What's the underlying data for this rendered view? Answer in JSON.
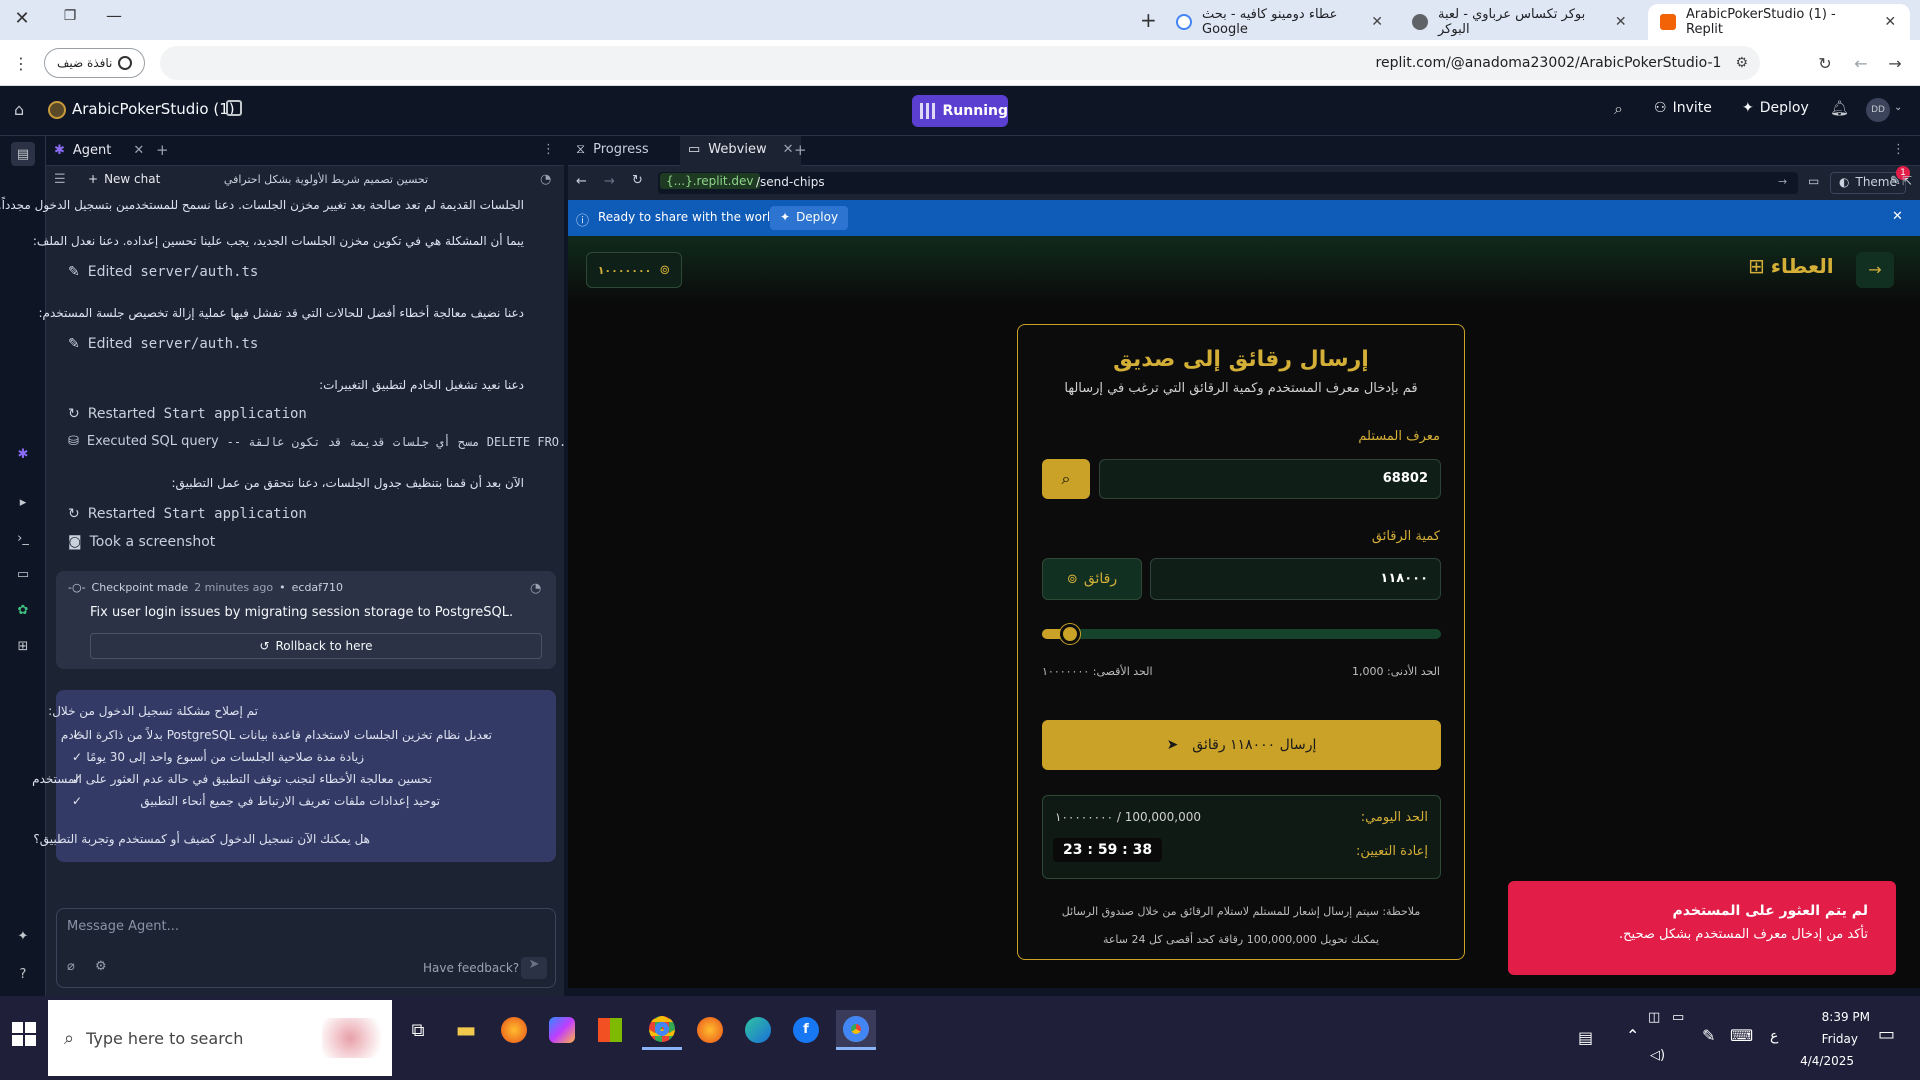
{
  "browser": {
    "tabs": [
      {
        "title": "ArabicPokerStudio (1) - Replit",
        "active": true
      },
      {
        "title": "بوكر تكساس عرباوي - لعبة البوكر",
        "active": false
      },
      {
        "title": "عطاء دومينو كافيه - بحث Google",
        "active": false
      }
    ],
    "url": "replit.com/@anadoma23002/ArabicPokerStudio-1",
    "guest_label": "نافذة ضيف"
  },
  "replit": {
    "project_name": "ArabicPokerStudio (1)",
    "run_status": "Running",
    "invite_label": "Invite",
    "deploy_label": "Deploy",
    "avatar_initials": "DD"
  },
  "agent": {
    "tab_label": "Agent",
    "new_chat_label": "New chat",
    "chat_title": "تحسين تصميم شريط الأولوية بشكل احترافي",
    "lines": [
      "الجلسات القديمة لم تعد صالحة بعد تغيير مخزن الجلسات. دعنا نسمح للمستخدمين بتسجيل الدخول مجدداً.",
      "يبما أن المشكلة هي في تكوين مخزن الجلسات الجديد، يجب علينا تحسين إعداده. دعنا نعدل الملف:",
      "دعنا نضيف معالجة أخطاء أفضل للحالات التي قد تفشل فيها عملية إزالة تخصيص جلسة المستخدم:",
      "دعنا نعيد تشغيل الخادم لتطبيق التغييرات:",
      "الآن بعد أن قمنا بتنظيف جدول الجلسات، دعنا نتحقق من عمل التطبيق:"
    ],
    "actions": [
      {
        "prefix": "Edited",
        "detail": "server/auth.ts"
      },
      {
        "prefix": "Edited",
        "detail": "server/auth.ts"
      },
      {
        "prefix": "Restarted",
        "detail": "Start application"
      },
      {
        "prefix": "Executed SQL query",
        "detail": "-- مسح أي جلسات قديمة قد تكون عالقة DELETE FRO..."
      },
      {
        "prefix": "Restarted",
        "detail": "Start application"
      },
      {
        "prefix": "Took a screenshot",
        "detail": ""
      }
    ],
    "checkpoint": {
      "label": "Checkpoint made",
      "time": "2 minutes ago",
      "commit": "ecdaf710",
      "message": "Fix user login issues by migrating session storage to PostgreSQL.",
      "rollback_label": "Rollback to here"
    },
    "summary": {
      "intro": "تم إصلاح مشكلة تسجيل الدخول من خلال:",
      "items": [
        "تعديل نظام تخزين الجلسات لاستخدام قاعدة بيانات PostgreSQL بدلاً من ذاكرة الخادم",
        "زيادة مدة صلاحية الجلسات من أسبوع واحد إلى 30 يومًا",
        "تحسين معالجة الأخطاء لتجنب توقف التطبيق في حالة عدم العثور على المستخدم",
        "توحيد إعدادات ملفات تعريف الارتباط في جميع أنحاء التطبيق"
      ],
      "question": "هل يمكنك الآن تسجيل الدخول كضيف أو كمستخدم وتجربة التطبيق؟"
    },
    "message_placeholder": "Message Agent...",
    "feedback_label": "Have feedback?"
  },
  "webview": {
    "tabs": [
      "Progress",
      "Webview"
    ],
    "domain": "{...}.replit.dev",
    "path": "/send-chips",
    "theme_label": "Theme",
    "notif_count": "1",
    "banner_text": "Ready to share with the world?",
    "banner_button": "Deploy"
  },
  "app": {
    "balance": "١٠٠٠٠٠٠٠",
    "brand": "العطاء",
    "title": "إرسال رقائق إلى صديق",
    "subtitle": "قم بإدخال معرف المستخدم وكمية الرقائق التي ترغب في إرسالها",
    "recipient_label": "معرف المستلم",
    "recipient_value": "68802",
    "amount_label": "كمية الرقائق",
    "amount_value": "١١٨٠٠٠",
    "chips_unit": "رقائق",
    "slider_fraction": 0.07,
    "min_label": "الحد الأدنى: 1,000",
    "max_label": "الحد الأقصى: ١٠٠٠٠٠٠٠",
    "send_button": "إرسال ١١٨٠٠٠ رقائق",
    "daily_label": "الحد اليومي:",
    "daily_value": "١٠٠٠٠٠٠٠٠ / 100,000,000",
    "reset_label": "إعادة التعيين:",
    "reset_value": "23 : 59 : 38",
    "note1": "ملاحظة: سيتم إرسال إشعار للمستلم لاستلام الرقائق من خلال صندوق الرسائل",
    "note2": "يمكنك تحويل 100,000,000 رقاقة كحد أقصى كل 24 ساعة",
    "toast_title": "لم يتم العثور على المستخدم",
    "toast_body": "تأكد من إدخال معرف المستخدم بشكل صحيح."
  },
  "taskbar": {
    "search_placeholder": "Type here to search",
    "time": "8:39 PM",
    "day": "Friday",
    "date": "4/4/2025",
    "lang": "ع"
  },
  "colors": {
    "gold": "#d4af37",
    "running": "#5b3fd1",
    "toast": "#e11d48",
    "banner": "#0f5bb8"
  }
}
